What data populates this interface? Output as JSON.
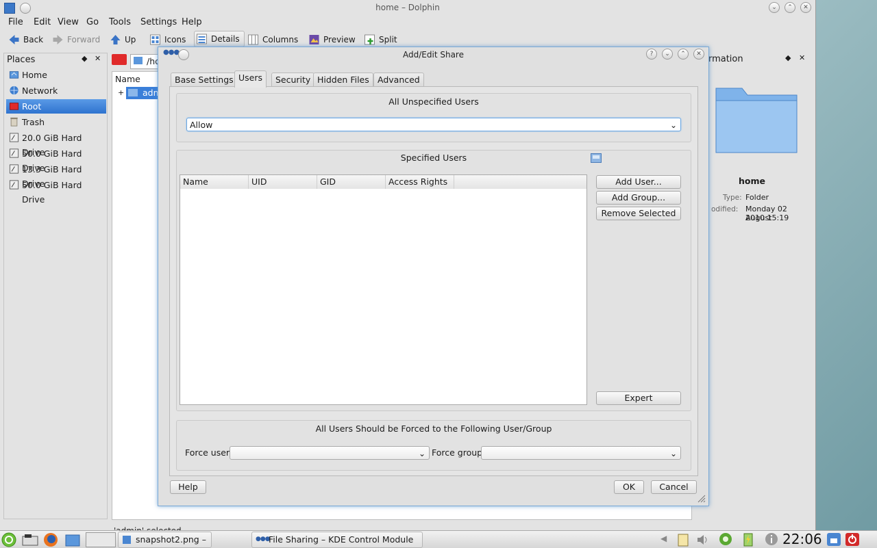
{
  "dolphin": {
    "title": "home – Dolphin",
    "menu": [
      "File",
      "Edit",
      "View",
      "Go",
      "Tools",
      "Settings",
      "Help"
    ],
    "toolbar": {
      "back": "Back",
      "forward": "Forward",
      "up": "Up",
      "icons": "Icons",
      "details": "Details",
      "columns": "Columns",
      "preview": "Preview",
      "split": "Split"
    },
    "places": {
      "title": "Places",
      "items": [
        "Home",
        "Network",
        "Root",
        "Trash",
        "20.0 GiB Hard Drive",
        "50.0 GiB Hard Drive",
        "13.3 GiB Hard Drive",
        "50.0 GiB Hard Drive"
      ],
      "selected": "Root"
    },
    "location_text": "/ho",
    "name_column": "Name",
    "tree_item": "adm",
    "status_text": "'admin' selected",
    "info": {
      "title": "ormation",
      "name": "home",
      "type_label": "Type:",
      "type_value": "Folder",
      "modified_label": "odified:",
      "modified_value_line1": "Monday 02 August",
      "modified_value_line2": "2010 15:19"
    }
  },
  "dialog": {
    "title": "Add/Edit Share",
    "tabs": [
      "Base Settings",
      "Users",
      "Security",
      "Hidden Files",
      "Advanced"
    ],
    "active_tab": "Users",
    "unspecified": {
      "title": "All Unspecified Users",
      "value": "Allow"
    },
    "specified": {
      "title": "Specified Users",
      "columns": [
        "Name",
        "UID",
        "GID",
        "Access Rights"
      ],
      "buttons": {
        "add_user": "Add User...",
        "add_group": "Add Group...",
        "remove_selected": "Remove Selected",
        "expert": "Expert"
      }
    },
    "forced": {
      "title": "All Users Should be Forced to the Following User/Group",
      "force_user_label": "Force user:",
      "force_group_label": "Force group:",
      "force_user_value": "",
      "force_group_value": ""
    },
    "buttons": {
      "help": "Help",
      "ok": "OK",
      "cancel": "Cancel"
    }
  },
  "taskbar": {
    "tasks": [
      "snapshot2.png –",
      "File Sharing – KDE Control Module"
    ],
    "hidden_task": "home – Dolphin",
    "clock": "22:06"
  },
  "colors": {
    "selection": "#3a7fd9",
    "dialog_border": "#7aa9d6",
    "power_button": "#d22a2a"
  }
}
